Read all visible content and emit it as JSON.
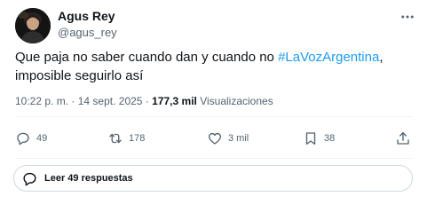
{
  "tweet": {
    "author_name": "Agus Rey",
    "author_handle": "@agus_rey",
    "text_before": "Que paja no saber cuando dan y cuando no ",
    "hashtag": "#LaVozArgentina",
    "text_after": ", imposible seguirlo así",
    "time": "10:22 p. m.",
    "separator": "·",
    "date": "14 sept. 2025",
    "views_count": "177,3 mil",
    "views_label": "Visualizaciones"
  },
  "actions": {
    "replies": "49",
    "reposts": "178",
    "likes": "3 mil",
    "bookmarks": "38"
  },
  "read_replies": "Leer 49 respuestas",
  "icons": {
    "more": "more-icon",
    "reply": "reply-icon",
    "repost": "repost-icon",
    "like": "like-icon",
    "bookmark": "bookmark-icon",
    "share": "share-icon",
    "comment": "comment-icon"
  },
  "colors": {
    "text": "#0f1419",
    "secondary": "#536471",
    "link": "#1d9bf0",
    "border": "#cfd9de"
  }
}
